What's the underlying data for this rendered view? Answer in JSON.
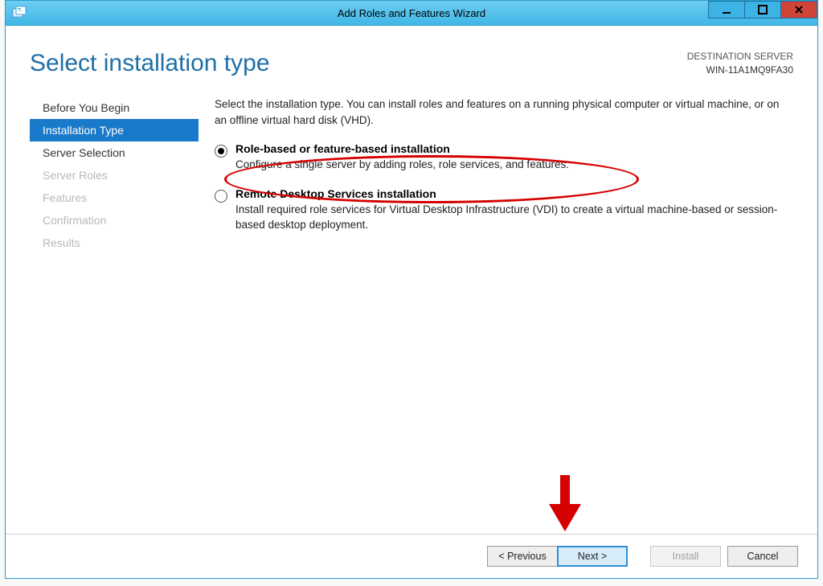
{
  "window": {
    "title": "Add Roles and Features Wizard"
  },
  "header": {
    "page_title": "Select installation type",
    "dest_label": "DESTINATION SERVER",
    "dest_name": "WIN-11A1MQ9FA30"
  },
  "sidebar": {
    "items": [
      {
        "label": "Before You Begin",
        "state": "enabled"
      },
      {
        "label": "Installation Type",
        "state": "selected"
      },
      {
        "label": "Server Selection",
        "state": "enabled"
      },
      {
        "label": "Server Roles",
        "state": "disabled"
      },
      {
        "label": "Features",
        "state": "disabled"
      },
      {
        "label": "Confirmation",
        "state": "disabled"
      },
      {
        "label": "Results",
        "state": "disabled"
      }
    ]
  },
  "main": {
    "intro": "Select the installation type. You can install roles and features on a running physical computer or virtual machine, or on an offline virtual hard disk (VHD).",
    "options": [
      {
        "title": "Role-based or feature-based installation",
        "desc": "Configure a single server by adding roles, role services, and features.",
        "selected": true
      },
      {
        "title": "Remote Desktop Services installation",
        "desc": "Install required role services for Virtual Desktop Infrastructure (VDI) to create a virtual machine-based or session-based desktop deployment.",
        "selected": false
      }
    ]
  },
  "buttons": {
    "previous": "< Previous",
    "next": "Next >",
    "install": "Install",
    "cancel": "Cancel"
  },
  "annotations": {
    "arrow_points_to": "next-button",
    "circle_highlights": "option-role-based"
  }
}
